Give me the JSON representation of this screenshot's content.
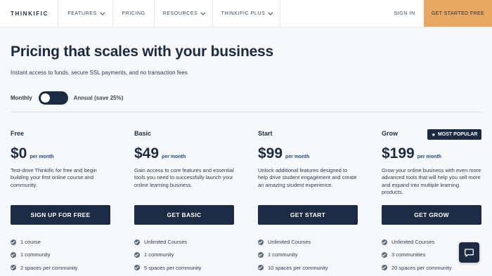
{
  "nav": {
    "logo": "THINKIFIC",
    "items": [
      "FEATURES",
      "PRICING",
      "RESOURCES",
      "THINKIFIC PLUS"
    ],
    "sign_in": "SIGN IN",
    "cta": "GET STARTED FREE"
  },
  "hero": {
    "title": "Pricing that scales with your business",
    "subtitle": "Instant access to funds, secure SSL payments, and no transaction fees"
  },
  "billing": {
    "monthly_label": "Monthly",
    "annual_label": "Annual (save 25%)",
    "selected": "Monthly"
  },
  "badge": {
    "label": "MOST POPULAR",
    "icon": "star-icon"
  },
  "plans": [
    {
      "name": "Free",
      "price": "$0",
      "period": "per month",
      "description": "Test-drive Thinkific for free and begin building your first online course and community.",
      "button": "SIGN UP FOR FREE",
      "features": [
        "1 course",
        "1 community",
        "2 spaces per community"
      ]
    },
    {
      "name": "Basic",
      "price": "$49",
      "period": "per month",
      "description": "Gain access to core features and essential tools you need to successfully launch your online learning business.",
      "button": "GET BASIC",
      "features": [
        "Unlimited Courses",
        "1 community",
        "5 spaces per community"
      ]
    },
    {
      "name": "Start",
      "price": "$99",
      "period": "per month",
      "description": "Unlock additional features designed to help drive student engagement and create an amazing student experience.",
      "button": "GET START",
      "features": [
        "Unlimited Courses",
        "1 community",
        "10 spaces per community"
      ]
    },
    {
      "name": "Grow",
      "price": "$199",
      "period": "per month",
      "description": "Grow your online business with even more advanced tools that will help you sell more and expand into multiple learning products.",
      "button": "GET GROW",
      "features": [
        "Unlimited Courses",
        "3 communities",
        "20 spaces per community"
      ]
    }
  ],
  "chat": {
    "icon": "chat-bubble-icon"
  },
  "colors": {
    "navy": "#1c2b44",
    "accent_orange": "#e8a862",
    "period_blue": "#1f4a8a",
    "background": "#f7f8f9"
  }
}
